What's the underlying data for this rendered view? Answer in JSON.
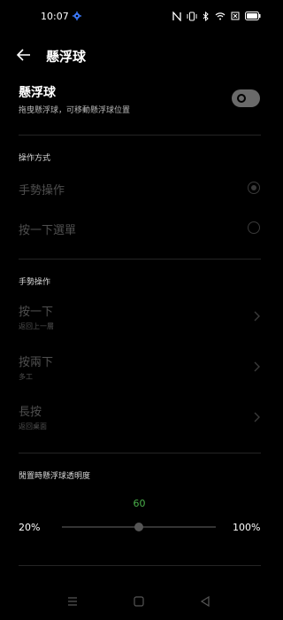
{
  "status": {
    "time": "10:07"
  },
  "header": {
    "title": "懸浮球"
  },
  "floating_ball": {
    "title": "懸浮球",
    "subtitle": "拖曳懸浮球，可移動懸浮球位置",
    "enabled": false
  },
  "operation_mode": {
    "section_label": "操作方式",
    "options": [
      {
        "label": "手勢操作",
        "selected": true
      },
      {
        "label": "按一下選單",
        "selected": false
      }
    ]
  },
  "gesture": {
    "section_label": "手勢操作",
    "rows": [
      {
        "title": "按一下",
        "subtitle": "返回上一層"
      },
      {
        "title": "按兩下",
        "subtitle": "多工"
      },
      {
        "title": "長按",
        "subtitle": "返回桌面"
      }
    ]
  },
  "opacity": {
    "label": "閒置時懸浮球透明度",
    "value": "60",
    "min_label": "20%",
    "max_label": "100%",
    "value_fraction": 0.5
  },
  "colors": {
    "background": "#000000",
    "accent": "#4ab04a"
  },
  "icons": [
    "settings-gear-icon",
    "nfc-icon",
    "vibrate-icon",
    "bluetooth-icon",
    "wifi-icon",
    "sim-icon",
    "battery-icon",
    "back-arrow-icon",
    "chevron-right-icon",
    "menu-icon",
    "home-icon",
    "back-icon"
  ]
}
